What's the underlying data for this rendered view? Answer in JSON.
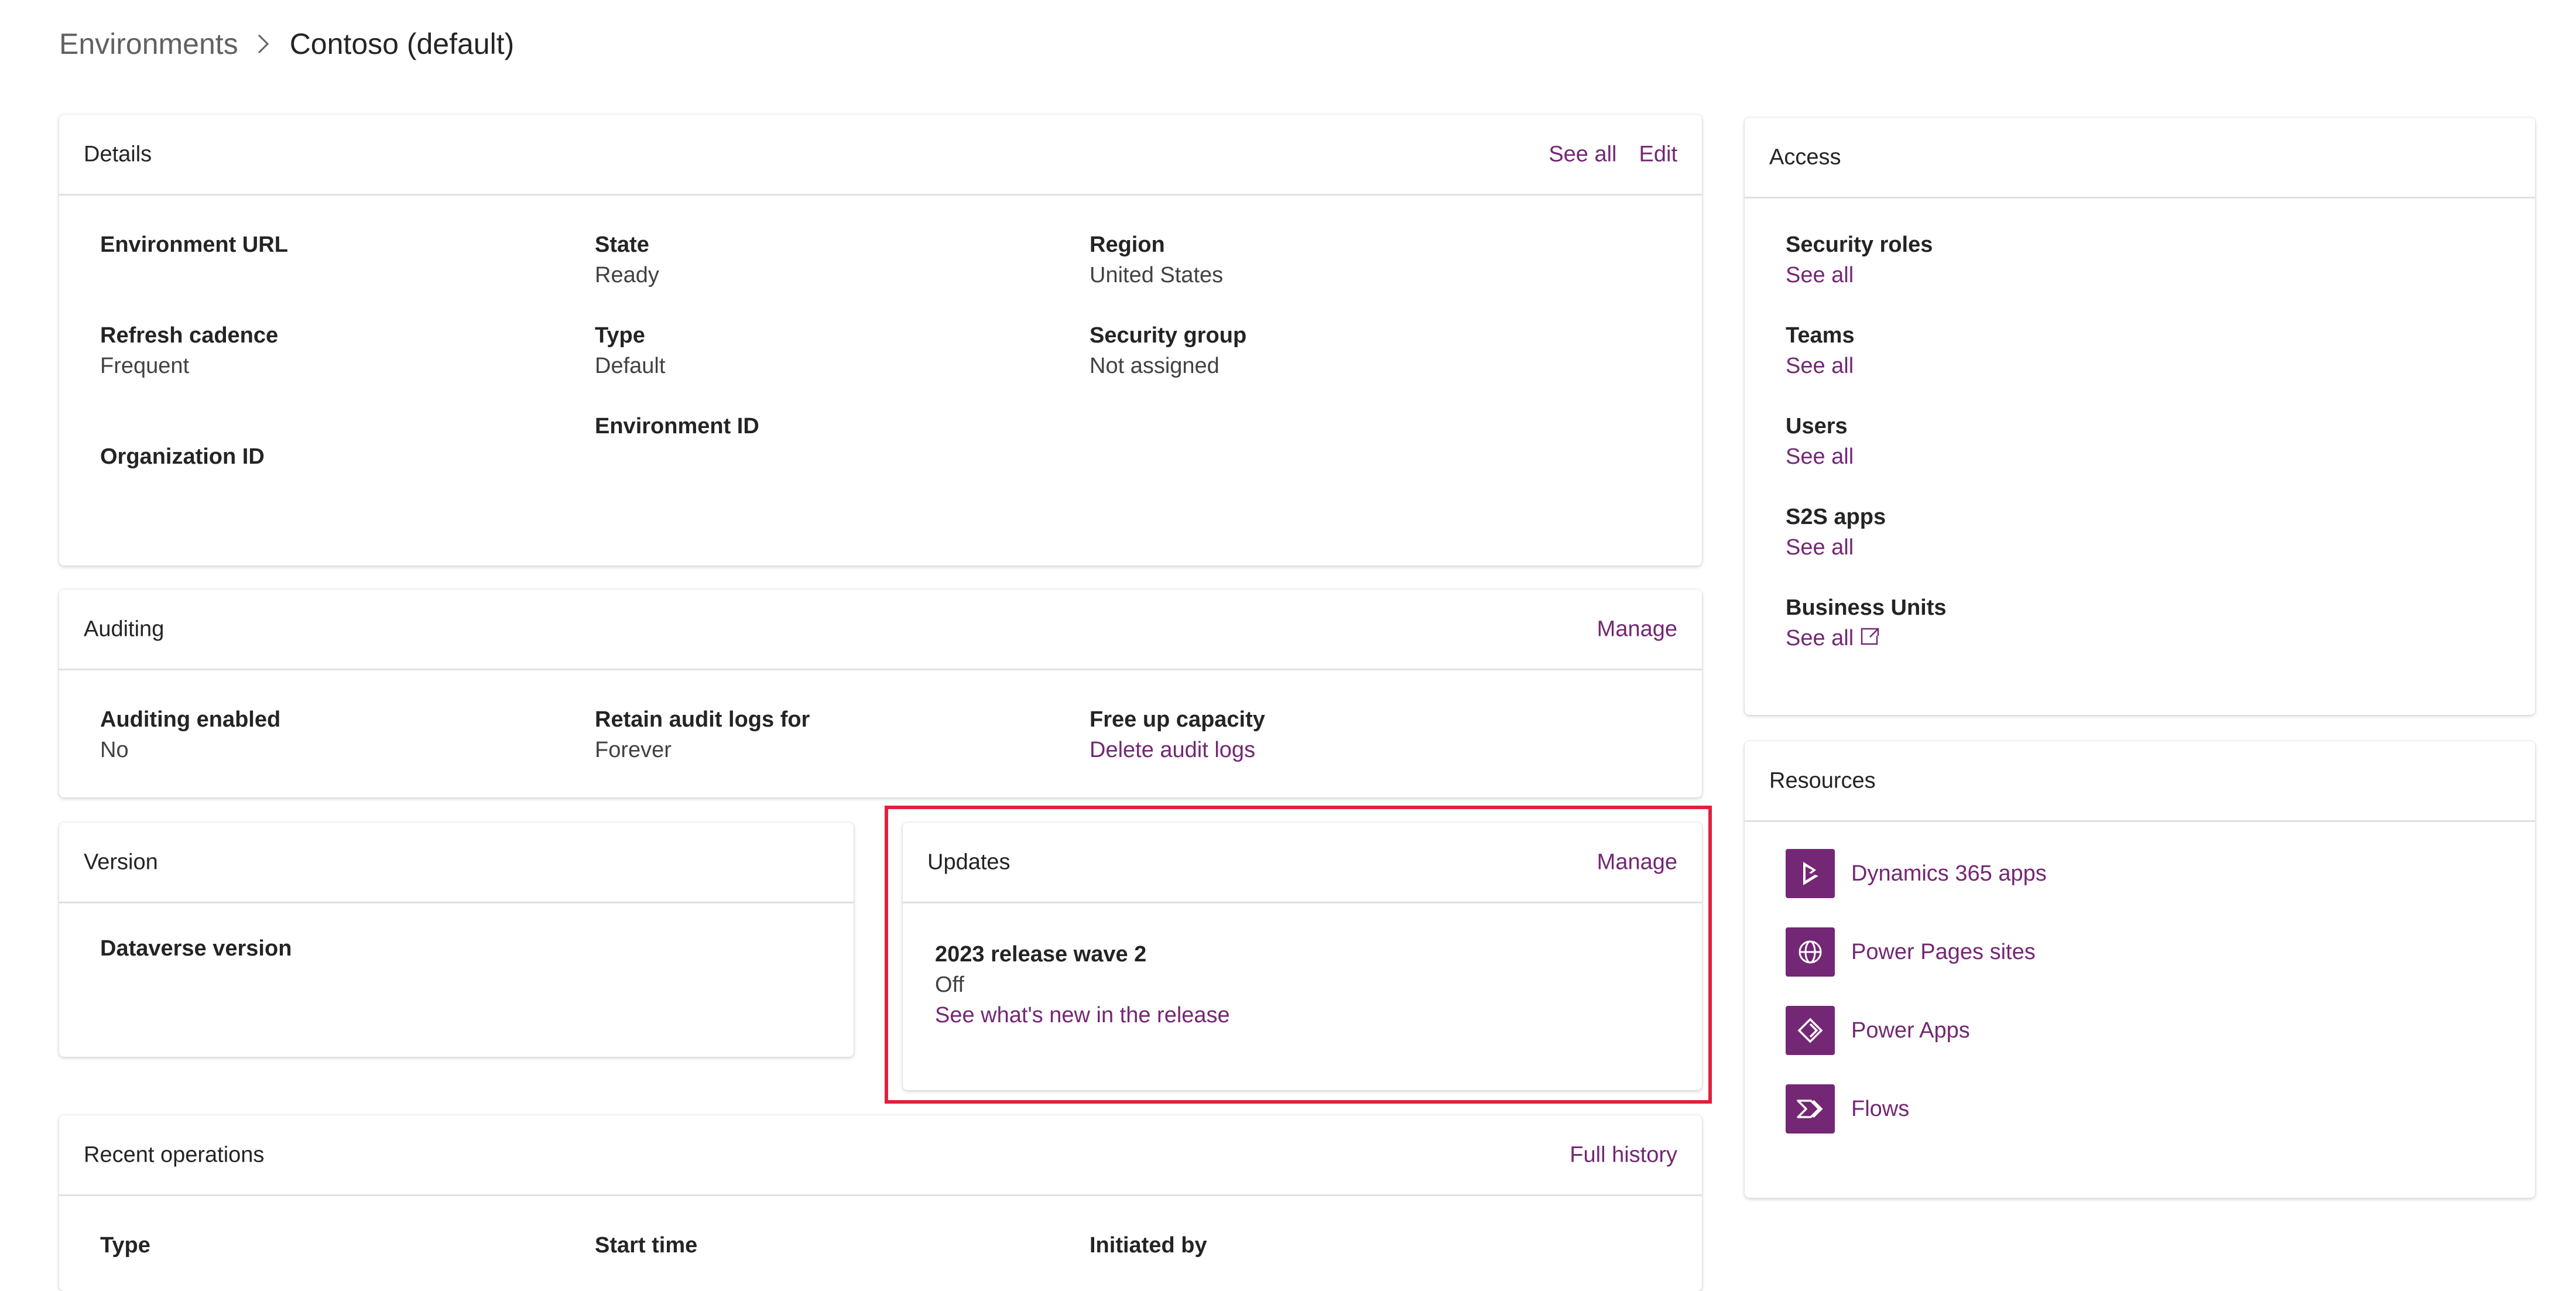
{
  "breadcrumb": {
    "parent": "Environments",
    "current": "Contoso (default)"
  },
  "details": {
    "title": "Details",
    "see_all": "See all",
    "edit": "Edit",
    "fields": {
      "environment_url": {
        "label": "Environment URL"
      },
      "state": {
        "label": "State",
        "value": "Ready"
      },
      "region": {
        "label": "Region",
        "value": "United States"
      },
      "refresh_cadence": {
        "label": "Refresh cadence",
        "value": "Frequent"
      },
      "type": {
        "label": "Type",
        "value": "Default"
      },
      "security_group": {
        "label": "Security group",
        "value": "Not assigned"
      },
      "environment_id": {
        "label": "Environment ID"
      },
      "organization_id": {
        "label": "Organization ID"
      }
    }
  },
  "auditing": {
    "title": "Auditing",
    "manage": "Manage",
    "fields": {
      "enabled": {
        "label": "Auditing enabled",
        "value": "No"
      },
      "retain": {
        "label": "Retain audit logs for",
        "value": "Forever"
      },
      "capacity": {
        "label": "Free up capacity",
        "link": "Delete audit logs"
      }
    }
  },
  "version": {
    "title": "Version",
    "dataverse_label": "Dataverse version"
  },
  "updates": {
    "title": "Updates",
    "manage": "Manage",
    "wave_label": "2023 release wave 2",
    "wave_status": "Off",
    "whats_new_link": "See what's new in the release"
  },
  "recent_operations": {
    "title": "Recent operations",
    "full_history": "Full history",
    "columns": [
      "Type",
      "Start time",
      "Initiated by"
    ]
  },
  "access": {
    "title": "Access",
    "items": [
      {
        "label": "Security roles",
        "link": "See all"
      },
      {
        "label": "Teams",
        "link": "See all"
      },
      {
        "label": "Users",
        "link": "See all"
      },
      {
        "label": "S2S apps",
        "link": "See all"
      },
      {
        "label": "Business Units",
        "link": "See all",
        "external": true
      }
    ]
  },
  "resources": {
    "title": "Resources",
    "items": [
      {
        "label": "Dynamics 365 apps",
        "icon": "dynamics-365-icon"
      },
      {
        "label": "Power Pages sites",
        "icon": "globe-icon"
      },
      {
        "label": "Power Apps",
        "icon": "power-apps-icon"
      },
      {
        "label": "Flows",
        "icon": "flows-icon"
      }
    ]
  },
  "colors": {
    "accent": "#742774",
    "highlight": "#e0213c",
    "divider": "#e0e0e0"
  }
}
